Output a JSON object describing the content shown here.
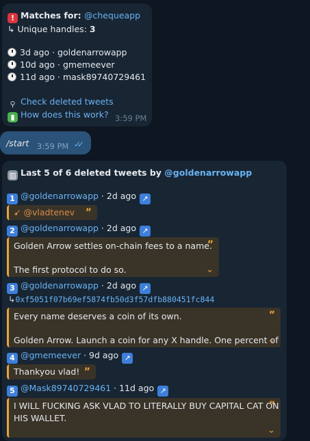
{
  "msg1": {
    "title_prefix": "Matches for:",
    "handle": "@chequeapp",
    "unique_label": "Unique handles:",
    "unique_count": "3",
    "entries": [
      {
        "ago": "3d ago",
        "name": "goldenarrowapp"
      },
      {
        "ago": "10d ago",
        "name": "gmemeever"
      },
      {
        "ago": "11d ago",
        "name": "mask89740729461"
      }
    ],
    "link_check": "Check deleted tweets",
    "link_how": "How does this work?",
    "time": "3:59 PM"
  },
  "msg2": {
    "text": "/start",
    "time": "3:59 PM"
  },
  "msg3": {
    "title_prefix": "Last 5 of 6 deleted tweets by",
    "title_handle": "@goldenarrowapp",
    "tweets": [
      {
        "num": "1",
        "handle": "@goldenarrowapp",
        "ago": "2d ago",
        "quote": [
          "@vladtenev"
        ]
      },
      {
        "num": "2",
        "handle": "@goldenarrowapp",
        "ago": "2d ago",
        "quote": [
          "Golden Arrow settles on-chain fees to a name.",
          "The first protocol to do so."
        ]
      },
      {
        "num": "3",
        "handle": "@goldenarrowapp",
        "ago": "2d ago",
        "hash": "0xf5051f07b69ef5874fb50d3f57dfb880451fc844",
        "quote": [
          "Every name deserves a coin of its own.",
          "Golden Arrow. Launch a coin for any X handle. One percent of"
        ]
      },
      {
        "num": "4",
        "handle": "@gmemeever",
        "ago": "9d ago",
        "quote": [
          "Thankyou vlad!"
        ]
      },
      {
        "num": "5",
        "handle": "@Mask89740729461",
        "ago": "11d ago",
        "quote": [
          "I WILL FUCKING ASK VLAD TO LITERALLY BUY CAPITAL CAT ON",
          "HIS WALLET."
        ]
      }
    ]
  },
  "colors": {
    "background": "#0e1621",
    "bubble": "#182533",
    "outgoing": "#2b5278",
    "link": "#6ab3f3",
    "quote_bar": "#e8a23d"
  }
}
